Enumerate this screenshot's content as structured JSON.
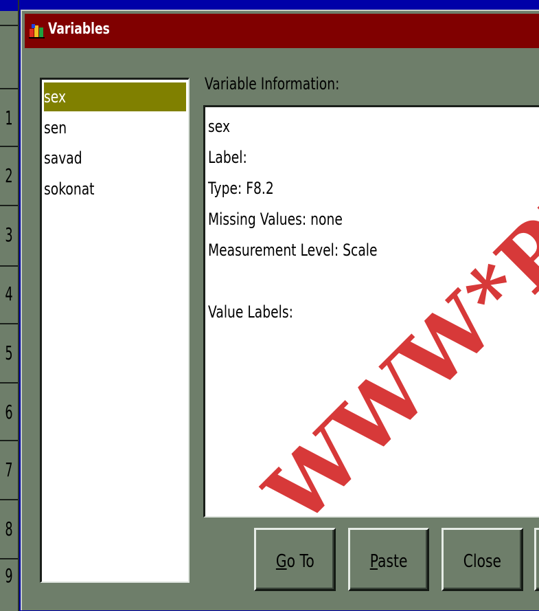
{
  "window": {
    "title": "Variables",
    "icon": "spss-app-icon"
  },
  "background_rows": [
    "1",
    "2",
    "3",
    "4",
    "5",
    "6",
    "7",
    "8",
    "9"
  ],
  "variable_list": {
    "items": [
      "sex",
      "sen",
      "savad",
      "sokonat"
    ],
    "selected": "sex"
  },
  "info": {
    "header": "Variable Information:",
    "lines": [
      "sex",
      "Label:",
      "Type:  F8.2",
      "Missing Values:  none",
      "Measurement Level:  Scale",
      "",
      "Value Labels:"
    ]
  },
  "buttons": {
    "goto": {
      "mnemonic": "G",
      "rest": "o To"
    },
    "paste": {
      "mnemonic": "P",
      "rest": "aste"
    },
    "close": "Close"
  },
  "watermark": "WWW*PP",
  "colors": {
    "desktop": "#0000a8",
    "titlebar": "#800000",
    "dialog_face": "#6e7e6a",
    "selection": "#808000",
    "watermark": "#d21e1e"
  }
}
